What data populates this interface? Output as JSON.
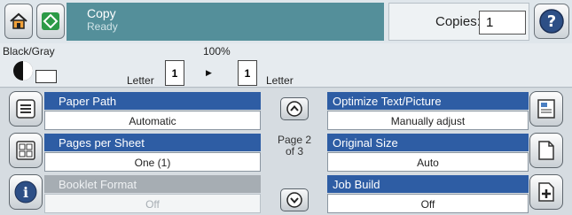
{
  "header": {
    "app_title": "Copy",
    "status": "Ready",
    "copies_label": "Copies:",
    "copies_value": "1"
  },
  "preview": {
    "color_mode": "Black/Gray",
    "scale": "100%",
    "source_size": "Letter",
    "source_count": "1",
    "dest_count": "1",
    "dest_size": "Letter"
  },
  "settings": {
    "paper_path": {
      "label": "Paper Path",
      "value": "Automatic"
    },
    "pages_per_sheet": {
      "label": "Pages per Sheet",
      "value": "One (1)"
    },
    "booklet_format": {
      "label": "Booklet Format",
      "value": "Off"
    },
    "optimize": {
      "label": "Optimize Text/Picture",
      "value": "Manually adjust"
    },
    "original_size": {
      "label": "Original Size",
      "value": "Auto"
    },
    "job_build": {
      "label": "Job Build",
      "value": "Off"
    }
  },
  "pager": {
    "line1": "Page 2",
    "line2": "of 3"
  },
  "icons": {
    "home": "home-icon",
    "copy": "copy-icon",
    "help": "help-icon",
    "up": "chevron-up-icon",
    "down": "chevron-down-icon"
  }
}
